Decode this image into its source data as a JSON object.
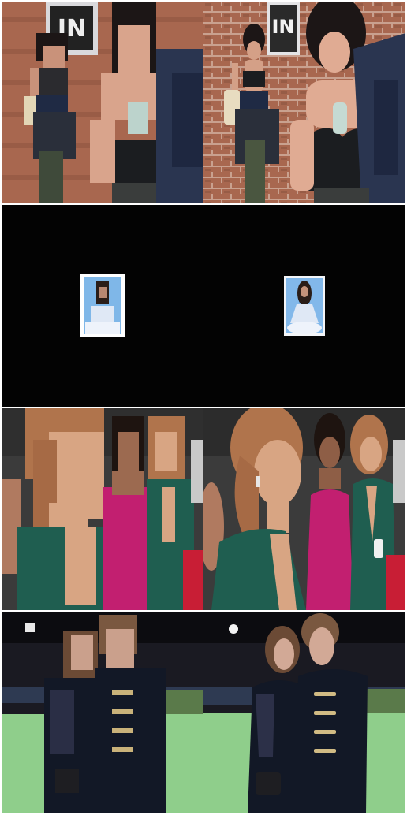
{
  "grid": {
    "rows": 4,
    "cols": 2,
    "columns": [
      "pixelated-input",
      "restored-output"
    ],
    "panels": [
      {
        "row": 1,
        "scene": "two-women-brick-wall",
        "sign_text": "IN",
        "colors": {
          "wall": "#a8674f",
          "wall_dark": "#7d4a39",
          "jacket": "#2a3550",
          "skin": "#d9a48c",
          "hair": "#1c1616",
          "top": "#1b1d20"
        }
      },
      {
        "row": 2,
        "scene": "small-photo-on-black",
        "colors": {
          "background": "#030303",
          "photo_bg": "#7fb7e8",
          "dress": "#dfe8f5",
          "hair": "#2a1d18"
        }
      },
      {
        "row": 3,
        "scene": "three-women-event",
        "colors": {
          "background": "#3b3b3b",
          "green_dress": "#1f5e50",
          "pink_dress": "#c21f70",
          "skin": "#d8a583",
          "hair": "#b0744c"
        }
      },
      {
        "row": 4,
        "scene": "couple-green-carpet",
        "colors": {
          "night": "#0c0c10",
          "carpet": "#8fce8b",
          "coat": "#121826",
          "buttons": "#c9b27a",
          "skin": "#caa08c",
          "hair": "#6b4a35"
        }
      }
    ]
  }
}
